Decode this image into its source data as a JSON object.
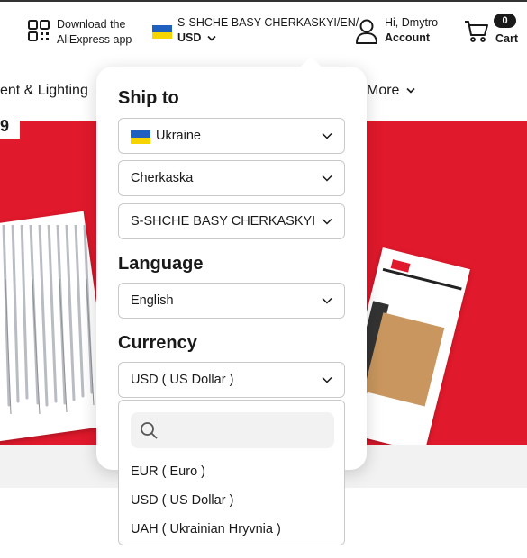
{
  "header": {
    "app_line1": "Download the",
    "app_line2": "AliExpress app",
    "location": "S-SHCHE BASY CHERKASKYI/EN/",
    "currency": "USD",
    "greeting": "Hi, Dmytro",
    "account_label": "Account",
    "cart_count": "0",
    "cart_label": "Cart"
  },
  "nav": {
    "left_category": "ent & Lighting",
    "more_label": "More"
  },
  "banner": {
    "price_fragment": "9",
    "colors": {
      "banner": "#e0192c"
    }
  },
  "panel": {
    "ship_to_title": "Ship to",
    "country": "Ukraine",
    "region": "Cherkaska",
    "city": "S-SHCHE BASY CHERKASKYI",
    "language_title": "Language",
    "language": "English",
    "currency_title": "Currency",
    "currency": "USD ( US Dollar )",
    "search_placeholder": "",
    "currency_options": [
      {
        "label": "EUR ( Euro )"
      },
      {
        "label": "USD ( US Dollar )"
      },
      {
        "label": "UAH ( Ukrainian Hryvnia )"
      }
    ]
  },
  "flag_colors": {
    "blue": "#1f5fbf",
    "yellow": "#f5d400"
  }
}
